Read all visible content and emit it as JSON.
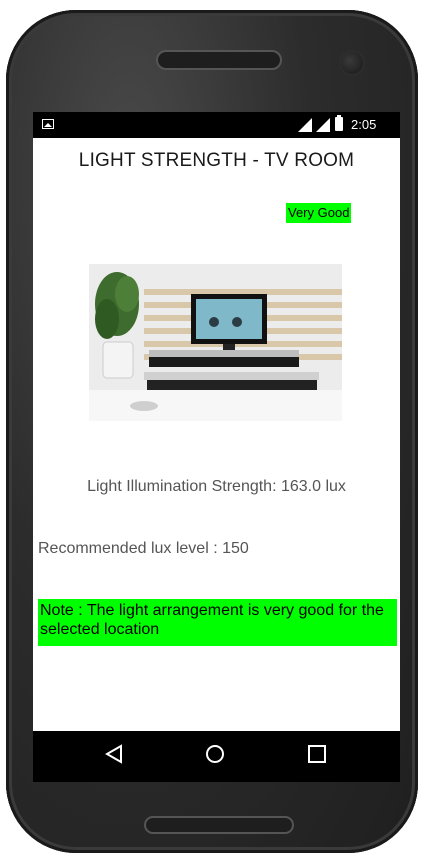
{
  "status_bar": {
    "time": "2:05",
    "icons": [
      "image-notification-icon",
      "signal-icon",
      "signal-icon",
      "battery-icon"
    ]
  },
  "screen": {
    "title": "LIGHT STRENGTH - TV ROOM",
    "rating_badge": "Very Good",
    "illumination_text": "Light Illumination Strength: 163.0 lux",
    "recommended_text": "Recommended lux level : 150",
    "note_text": "Note : The light arrangement is very good for the selected location"
  },
  "nav": {
    "icons": [
      "back-icon",
      "home-icon",
      "recents-icon"
    ]
  },
  "colors": {
    "accent_green": "#00ff00",
    "bar_black": "#000000",
    "text_gray": "#555555"
  }
}
